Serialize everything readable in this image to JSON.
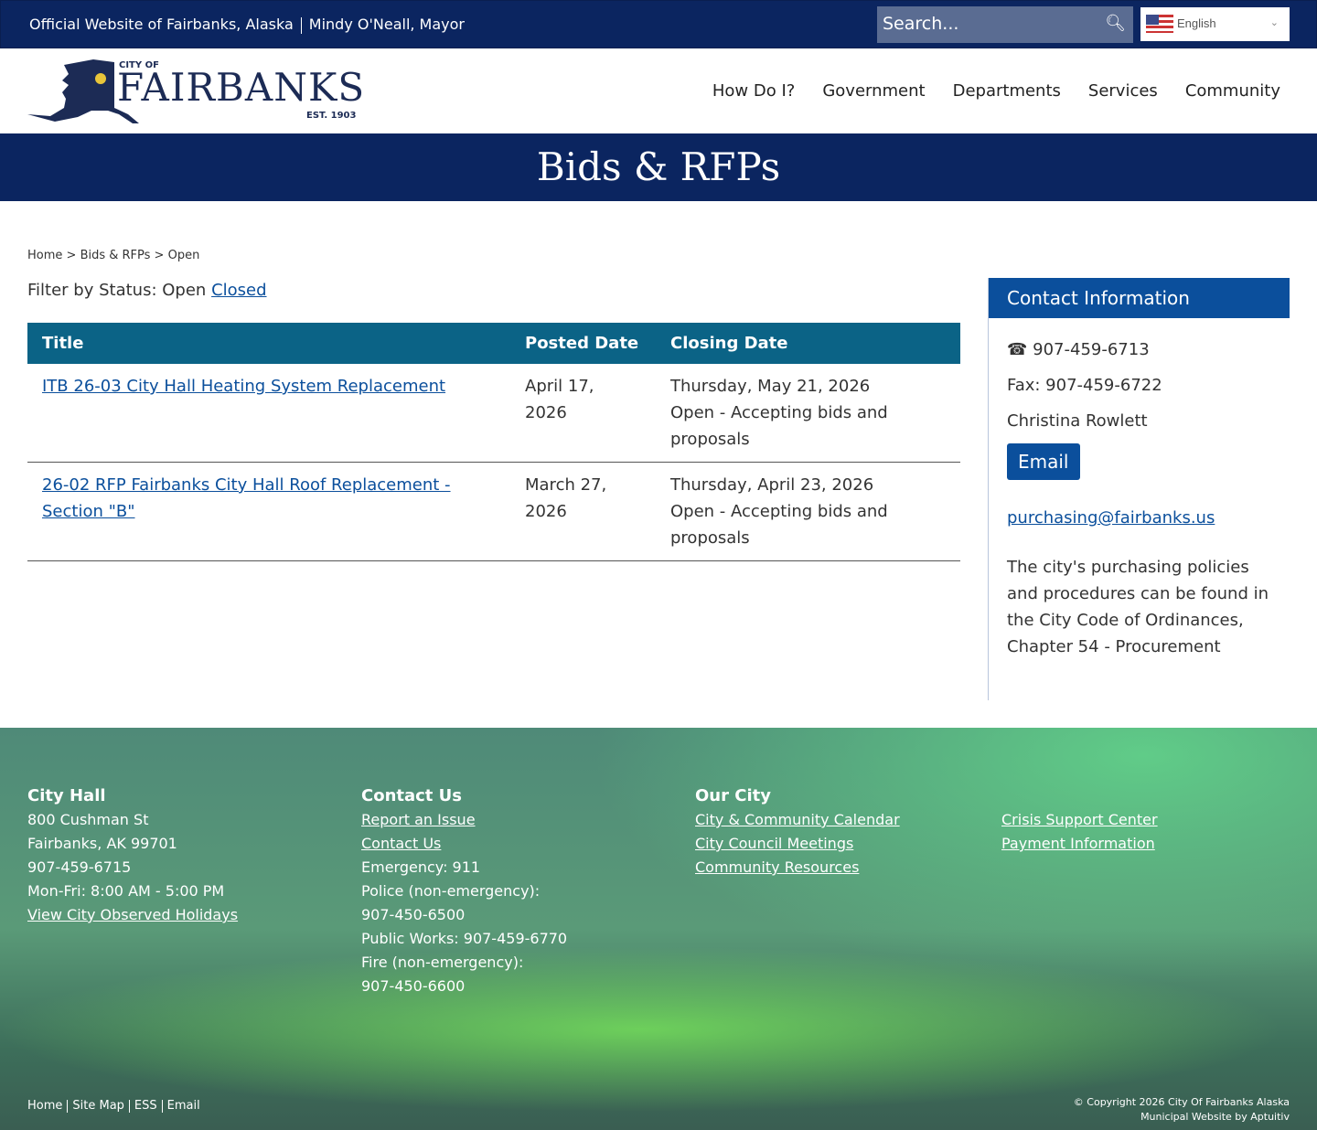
{
  "topbar": {
    "official": "Official Website of Fairbanks, Alaska",
    "mayor": "Mindy O'Neall, Mayor",
    "search_placeholder": "Search...",
    "language": "English"
  },
  "logo": {
    "city_of": "CITY OF",
    "name": "FAIRBANKS",
    "est": "EST. 1903"
  },
  "nav": [
    "How Do I?",
    "Government",
    "Departments",
    "Services",
    "Community"
  ],
  "banner": {
    "title": "Bids & RFPs"
  },
  "breadcrumb": {
    "home": "Home",
    "section": "Bids & RFPs",
    "current": "Open"
  },
  "filter": {
    "label": "Filter by Status: Open",
    "closed": "Closed"
  },
  "table": {
    "headers": [
      "Title",
      "Posted Date",
      "Closing Date"
    ],
    "rows": [
      {
        "title": "ITB 26-03 City Hall Heating System Replacement",
        "posted": "April 17, 2026",
        "closing": "Thursday, May 21, 2026",
        "status": "Open - Accepting bids and proposals"
      },
      {
        "title": "26-02 RFP Fairbanks City Hall Roof Replacement - Section \"B\"",
        "posted": "March 27, 2026",
        "closing": "Thursday, April 23, 2026",
        "status": "Open - Accepting bids and proposals"
      }
    ]
  },
  "contact": {
    "heading": "Contact Information",
    "phone": "907-459-6713",
    "fax": "Fax: 907-459-6722",
    "name": "Christina Rowlett",
    "email_button": "Email",
    "email": "purchasing@fairbanks.us",
    "policy": "The city's purchasing policies and procedures can be found in the City Code of Ordinances, Chapter 54 - Procurement"
  },
  "footer": {
    "city_hall": {
      "heading": "City Hall",
      "lines": [
        "800 Cushman St",
        "Fairbanks, AK 99701",
        "907-459-6715",
        "Mon-Fri: 8:00 AM - 5:00 PM"
      ],
      "link": "View City Observed Holidays"
    },
    "contact": {
      "heading": "Contact Us",
      "links": [
        "Report an Issue",
        "Contact Us"
      ],
      "lines": [
        "Emergency: 911",
        "Police (non-emergency):",
        "907-450-6500",
        "Public Works: 907-459-6770",
        "Fire (non-emergency):",
        "907-450-6600"
      ]
    },
    "our_city": {
      "heading": "Our City",
      "links": [
        "City & Community Calendar",
        "City Council Meetings",
        "Community Resources"
      ]
    },
    "more": {
      "links": [
        "Crisis Support Center",
        "Payment Information"
      ]
    },
    "bottom_links": [
      "Home",
      "Site Map",
      "ESS",
      "Email"
    ],
    "copyright": "© Copyright 2026 City Of Fairbanks Alaska",
    "credit": "Municipal Website by Aptuitiv"
  }
}
